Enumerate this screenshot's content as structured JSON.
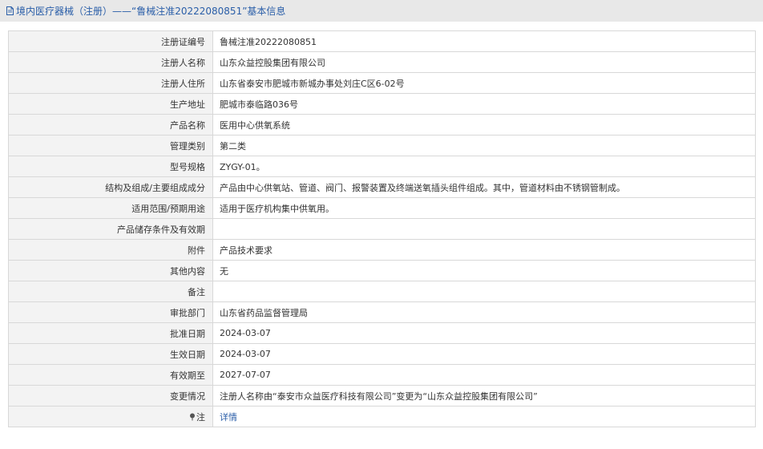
{
  "header": {
    "title": "境内医疗器械（注册）——“鲁械注准20222080851”基本信息"
  },
  "rows": [
    {
      "label": "注册证编号",
      "value": "鲁械注准20222080851"
    },
    {
      "label": "注册人名称",
      "value": "山东众益控股集团有限公司"
    },
    {
      "label": "注册人住所",
      "value": "山东省泰安市肥城市新城办事处刘庄C区6-02号"
    },
    {
      "label": "生产地址",
      "value": "肥城市泰临路036号"
    },
    {
      "label": "产品名称",
      "value": "医用中心供氧系统"
    },
    {
      "label": "管理类别",
      "value": "第二类"
    },
    {
      "label": "型号规格",
      "value": "ZYGY-01。"
    },
    {
      "label": "结构及组成/主要组成成分",
      "value": "产品由中心供氧站、管道、阀门、报警装置及终端送氧插头组件组成。其中，管道材料由不锈钢管制成。"
    },
    {
      "label": "适用范围/预期用途",
      "value": "适用于医疗机构集中供氧用。"
    },
    {
      "label": "产品储存条件及有效期",
      "value": ""
    },
    {
      "label": "附件",
      "value": "产品技术要求"
    },
    {
      "label": "其他内容",
      "value": "无"
    },
    {
      "label": "备注",
      "value": ""
    },
    {
      "label": "审批部门",
      "value": "山东省药品监督管理局"
    },
    {
      "label": "批准日期",
      "value": "2024-03-07"
    },
    {
      "label": "生效日期",
      "value": "2024-03-07"
    },
    {
      "label": "有效期至",
      "value": "2027-07-07"
    },
    {
      "label": "变更情况",
      "value": "注册人名称由“泰安市众益医疗科技有限公司”变更为“山东众益控股集团有限公司”"
    }
  ],
  "note_row": {
    "label": "注",
    "link_text": "详情",
    "icon": "pin-icon"
  },
  "colors": {
    "title_text": "#2a5ea8",
    "title_bg": "#e8e8e8",
    "label_bg": "#f3f3f3",
    "border": "#d8d8d8",
    "link": "#2a5ea8"
  }
}
